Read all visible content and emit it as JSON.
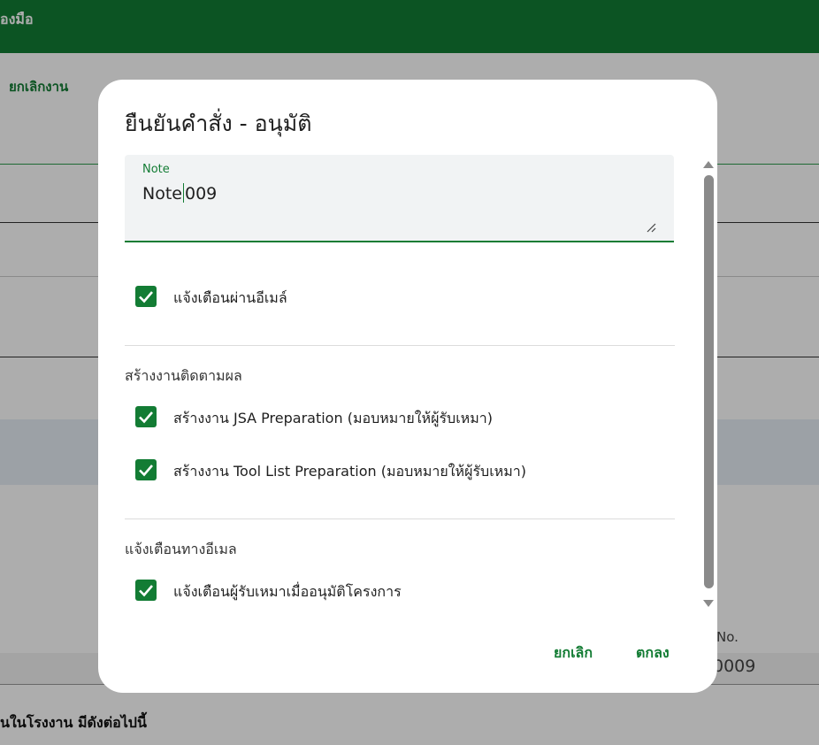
{
  "background": {
    "header_title": "ื่องมือ",
    "toolbar_link": "ยกเลิกงาน",
    "field_label": "No.",
    "field_value": "0009",
    "bottom_text": "นในโรงงาน มีดังต่อไปนี้"
  },
  "dialog": {
    "title": "ยืนยันคำสั่ง - อนุมัติ",
    "note": {
      "label": "Note",
      "value_before_caret": "Note",
      "value_after_caret": "009"
    },
    "email_notify": {
      "label": "แจ้งเตือนผ่านอีเมล์",
      "checked": true
    },
    "followup": {
      "title": "สร้างงานติดตามผล",
      "items": [
        {
          "label": "สร้างงาน JSA Preparation (มอบหมายให้ผู้รับเหมา)",
          "checked": true
        },
        {
          "label": "สร้างงาน Tool List Preparation (มอบหมายให้ผู้รับเหมา)",
          "checked": true
        }
      ]
    },
    "email_section": {
      "title": "แจ้งเตือนทางอีเมล",
      "items": [
        {
          "label": "แจ้งเตือนผู้รับเหมาเมื่ออนุมัติโครงการ",
          "checked": true
        }
      ]
    },
    "buttons": {
      "cancel": "ยกเลิก",
      "ok": "ตกลง"
    }
  },
  "colors": {
    "primary": "#137c34",
    "header": "#137c34",
    "field_fill": "#f1f3f4",
    "scrim": "rgba(0,0,0,0.32)"
  }
}
